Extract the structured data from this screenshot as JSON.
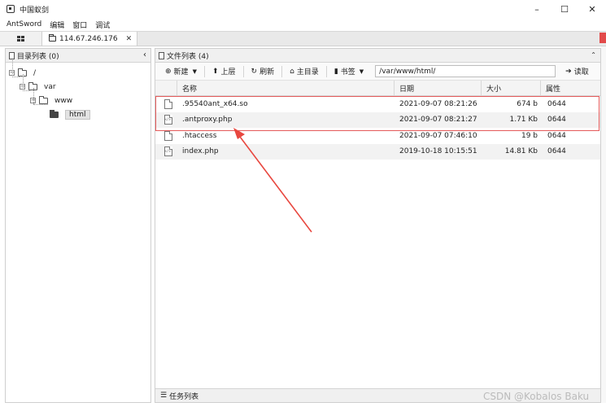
{
  "window": {
    "title": "中国蚁剑",
    "minimize_glyph": "–",
    "maximize_glyph": "☐",
    "close_glyph": "✕"
  },
  "menu": {
    "items": [
      "AntSword",
      "编辑",
      "窗口",
      "调试"
    ]
  },
  "tabs": {
    "home_icon": "grid-icon",
    "host_label": "114.67.246.176",
    "close_glyph": "✕"
  },
  "left_panel": {
    "title": "目录列表 (0)",
    "collapse_glyph": "‹",
    "tree": [
      {
        "label": "/",
        "toggle": "−"
      },
      {
        "label": "var",
        "toggle": "−"
      },
      {
        "label": "www",
        "toggle": "−"
      },
      {
        "label": "html",
        "selected": true
      }
    ]
  },
  "right_panel": {
    "title": "文件列表 (4)",
    "collapse_glyph": "⌃",
    "toolbar": {
      "new_label": "新建",
      "up_label": "上层",
      "refresh_label": "刷新",
      "home_label": "主目录",
      "bookmark_label": "书签",
      "path_value": "/var/www/html/",
      "read_label": "读取"
    },
    "columns": {
      "name": "名称",
      "date": "日期",
      "size": "大小",
      "attr": "属性"
    },
    "files": [
      {
        "name": ".95540ant_x64.so",
        "date": "2021-09-07 08:21:26",
        "size": "674 b",
        "attr": "0644",
        "icon": "file-icon"
      },
      {
        "name": ".antproxy.php",
        "date": "2021-09-07 08:21:27",
        "size": "1.71 Kb",
        "attr": "0644",
        "icon": "code-file-icon"
      },
      {
        "name": ".htaccess",
        "date": "2021-09-07 07:46:10",
        "size": "19 b",
        "attr": "0644",
        "icon": "file-icon"
      },
      {
        "name": "index.php",
        "date": "2019-10-18 10:15:51",
        "size": "14.81 Kb",
        "attr": "0644",
        "icon": "code-file-icon"
      }
    ],
    "tasks_label": "任务列表"
  },
  "annotation": {
    "highlight_color": "#e45b5b",
    "arrow_color": "#e8473f"
  },
  "watermark": "CSDN @Kobalos Baku"
}
